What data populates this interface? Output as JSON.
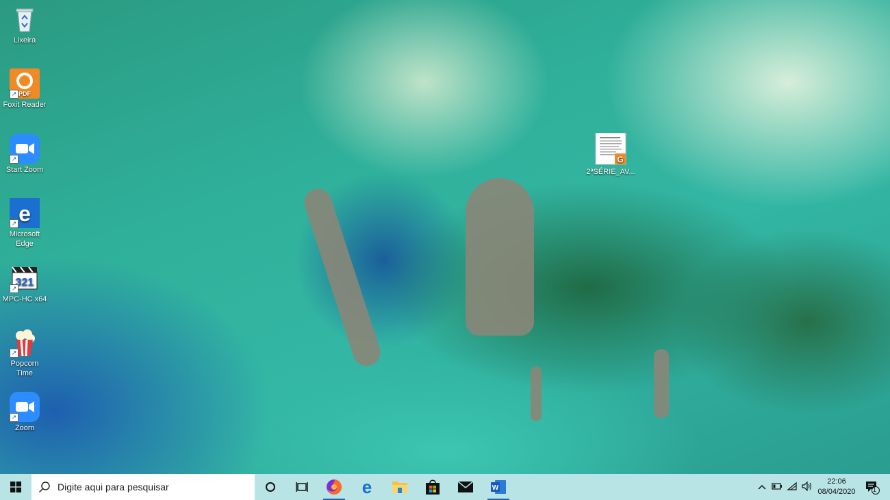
{
  "desktop": {
    "icons": [
      {
        "label": "Lixeira",
        "icon": "recycle-bin-icon"
      },
      {
        "label": "Foxit Reader",
        "icon": "foxit-reader-icon"
      },
      {
        "label": "Start Zoom",
        "icon": "zoom-icon"
      },
      {
        "label": "Microsoft Edge",
        "icon": "edge-icon"
      },
      {
        "label": "MPC-HC x64",
        "icon": "mpc-hc-icon"
      },
      {
        "label": "Popcorn Time",
        "icon": "popcorn-time-icon"
      },
      {
        "label": "Zoom",
        "icon": "zoom-icon"
      }
    ],
    "file": {
      "label": "2ªSÉRIE_AV...",
      "icon": "pdf-document-icon",
      "badge": "G"
    }
  },
  "taskbar": {
    "search_placeholder": "Digite aqui para pesquisar",
    "apps": [
      {
        "name": "Firefox",
        "icon": "firefox-icon",
        "active": true
      },
      {
        "name": "Microsoft Edge",
        "icon": "edge-icon",
        "active": false
      },
      {
        "name": "File Explorer",
        "icon": "folder-icon",
        "active": false
      },
      {
        "name": "Microsoft Store",
        "icon": "store-icon",
        "active": false
      },
      {
        "name": "Mail",
        "icon": "mail-icon",
        "active": false
      },
      {
        "name": "Word",
        "icon": "word-icon",
        "active": true
      }
    ],
    "clock": {
      "time": "22:06",
      "date": "08/04/2020"
    },
    "notification_count": "1"
  },
  "colors": {
    "taskbar": "#b8e4e6",
    "accent": "#1a5fb4",
    "zoom": "#2d8cff",
    "foxit": "#f08a24"
  }
}
